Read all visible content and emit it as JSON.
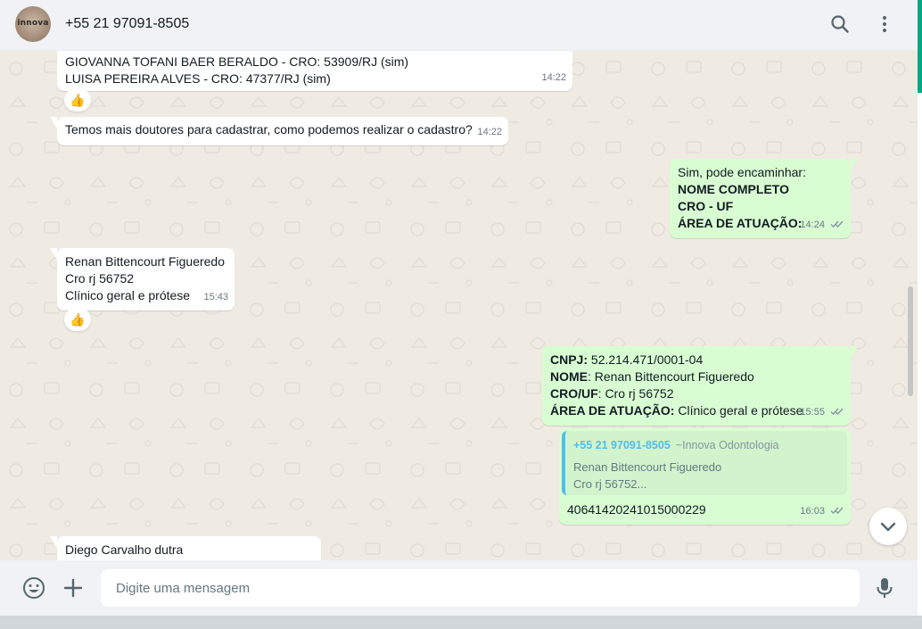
{
  "header": {
    "avatar_text": "innova",
    "contact_name": "+55 21 97091-8505",
    "search_icon": "search-icon",
    "menu_icon": "kebab-menu-icon"
  },
  "colors": {
    "incoming_bubble": "#ffffff",
    "outgoing_bubble": "#d9fdd3",
    "wallpaper": "#efeae2",
    "accent": "#00a884",
    "quote_author": "#53bdeb",
    "read_ticks": "#8696a0"
  },
  "messages": [
    {
      "direction": "in",
      "lines": [
        "GIOVANNA TOFANI BAER BERALDO - CRO: 53909/RJ (sim)",
        "LUISA PEREIRA ALVES - CRO: 47377/RJ (sim)"
      ],
      "time": "14:22",
      "reaction": "👍"
    },
    {
      "direction": "in",
      "lines": [
        "Temos mais doutores para cadastrar, como podemos realizar o cadastro?"
      ],
      "time": "14:22"
    },
    {
      "direction": "out",
      "lines": [
        "Sim, pode encaminhar:",
        "NOME COMPLETO",
        "CRO - UF",
        "ÁREA DE ATUAÇÃO:"
      ],
      "time": "14:24",
      "status": "read"
    },
    {
      "direction": "in",
      "lines": [
        "Renan Bittencourt Figueredo",
        "Cro rj 56752",
        "Clínico geral e prótese"
      ],
      "time": "15:43",
      "reaction": "👍"
    },
    {
      "direction": "out",
      "fields": [
        {
          "label": "CNPJ:",
          "value": " 52.214.471/0001-04"
        },
        {
          "label": "NOME",
          "value": ": Renan Bittencourt Figueredo"
        },
        {
          "label": "CRO/UF",
          "value": ": Cro rj 56752"
        },
        {
          "label": "ÁREA DE ATUAÇÃO:",
          "value": " Clínico geral e prótese"
        }
      ],
      "time": "15:55",
      "status": "read"
    },
    {
      "direction": "out",
      "quote": {
        "author": "+55 21 97091-8505",
        "pushname": "~Innova Odontologia",
        "lines": [
          "Renan Bittencourt Figueredo",
          "Cro rj 56752..."
        ]
      },
      "text": "40641420241015000229",
      "time": "16:03",
      "status": "read"
    },
    {
      "direction": "in",
      "lines": [
        "Diego Carvalho dutra"
      ]
    }
  ],
  "composer": {
    "placeholder": "Digite uma mensagem",
    "emoji_icon": "emoji-icon",
    "attach_icon": "plus-icon",
    "mic_icon": "microphone-icon"
  },
  "scroll_down_icon": "chevron-down-icon"
}
